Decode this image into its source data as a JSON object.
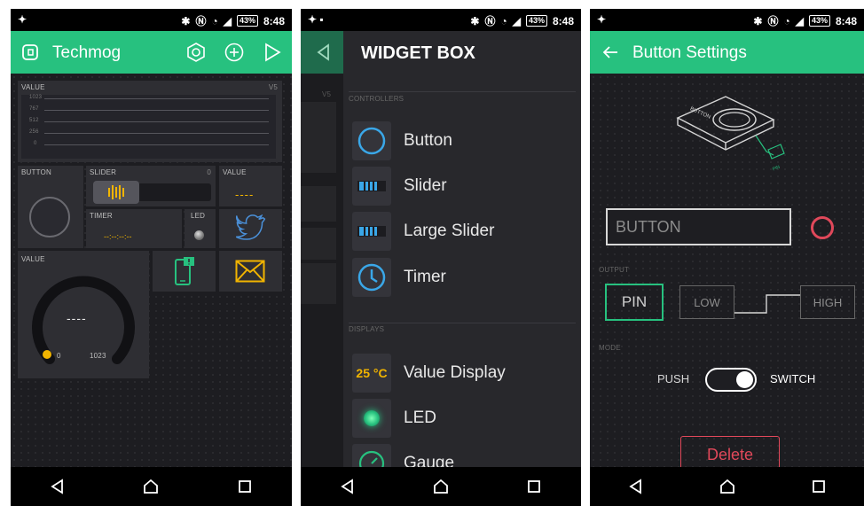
{
  "status_bar": {
    "time": "8:48",
    "battery": "43%"
  },
  "screen1": {
    "title": "Techmog",
    "value_widget": {
      "label": "VALUE",
      "pin": "V5",
      "ticks": [
        "1023",
        "767",
        "512",
        "256",
        "0"
      ]
    },
    "button_widget": {
      "label": "BUTTON"
    },
    "slider_widget": {
      "label": "SLIDER",
      "value": "0"
    },
    "value2_widget": {
      "label": "VALUE",
      "display": "----"
    },
    "timer_widget": {
      "label": "TIMER",
      "display": "--:--:--:--"
    },
    "led_widget": {
      "label": "LED"
    },
    "gauge_widget": {
      "label": "VALUE",
      "display": "----",
      "min": "0",
      "max": "1023"
    }
  },
  "screen2": {
    "title": "WIDGET BOX",
    "controllers_header": "CONTROLLERS",
    "controllers": [
      "Button",
      "Slider",
      "Large Slider",
      "Timer"
    ],
    "displays_header": "DISPLAYS",
    "displays": [
      "Value Display",
      "LED",
      "Gauge"
    ],
    "value_display_icon_text": "25 °C",
    "peek_label": "V5"
  },
  "screen3": {
    "title": "Button Settings",
    "name_field_value": "BUTTON",
    "output_label": "OUTPUT",
    "pin_label": "PIN",
    "low_label": "LOW",
    "high_label": "HIGH",
    "mode_label": "MODE",
    "push_label": "PUSH",
    "switch_label": "SWITCH",
    "illustration_button_text": "BUTTON",
    "illustration_pin_text": "PIN",
    "delete_label": "Delete"
  },
  "colors": {
    "accent_green": "#27c17f",
    "gold": "#f1b400",
    "twitter_blue": "#4a90d9",
    "danger_red": "#e0485a",
    "dark_bg": "#222226"
  }
}
